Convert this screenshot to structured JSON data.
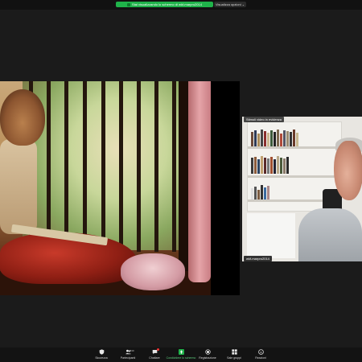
{
  "top_bar": {
    "share_status": "Stai visualizzando lo schermo di wkf-marpro2014",
    "view_options": "Visualizza opzioni ⌄",
    "accent_color": "#1fb34a"
  },
  "participant": {
    "top_label": "Stimoli video in evidenza",
    "name": "wkf-marpro2014"
  },
  "toolbar": {
    "items": [
      {
        "label": "Sicurezza",
        "icon": "shield-icon"
      },
      {
        "label": "Partecipanti",
        "icon": "participants-icon",
        "count": "840"
      },
      {
        "label": "Chattare",
        "icon": "chat-icon"
      },
      {
        "label": "Condividere lo schermo",
        "icon": "share-screen-icon"
      },
      {
        "label": "Registrazione",
        "icon": "record-icon"
      },
      {
        "label": "Sale gruppi",
        "icon": "breakout-rooms-icon"
      },
      {
        "label": "Reazioni",
        "icon": "reactions-icon"
      }
    ]
  }
}
